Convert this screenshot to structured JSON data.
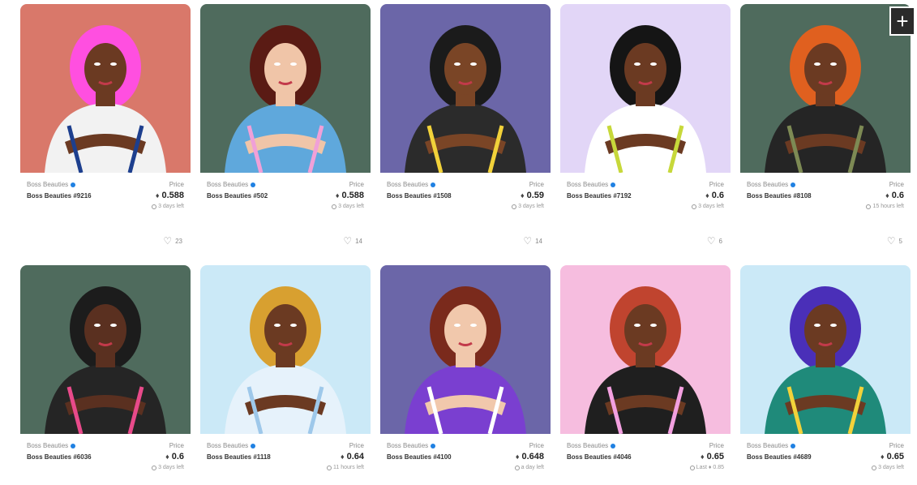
{
  "plus_button": {
    "label": "+"
  },
  "cards": [
    {
      "collection": "Boss Beauties",
      "name": "Boss Beauties #9216",
      "price_label": "Price",
      "price": "0.588",
      "time": "3 days left",
      "likes": "23",
      "bg": "#d9786a",
      "hair": "#ff4fe0",
      "top": "#f2f2f2",
      "accent": "#1d3f8e"
    },
    {
      "collection": "Boss Beauties",
      "name": "Boss Beauties #502",
      "price_label": "Price",
      "price": "0.588",
      "time": "3 days left",
      "likes": "14",
      "bg": "#4f6b5d",
      "hair": "#5a1b14",
      "top": "#5fa8dc",
      "accent": "#f0a0d8"
    },
    {
      "collection": "Boss Beauties",
      "name": "Boss Beauties #1508",
      "price_label": "Price",
      "price": "0.59",
      "time": "3 days left",
      "likes": "14",
      "bg": "#6b66a8",
      "hair": "#1b1b1b",
      "top": "#2b2b2b",
      "accent": "#f2d23a"
    },
    {
      "collection": "Boss Beauties",
      "name": "Boss Beauties #7192",
      "price_label": "Price",
      "price": "0.6",
      "time": "3 days left",
      "likes": "6",
      "bg": "#e2d6f7",
      "hair": "#151515",
      "top": "#ffffff",
      "accent": "#c7d83a"
    },
    {
      "collection": "Boss Beauties",
      "name": "Boss Beauties #8108",
      "price_label": "Price",
      "price": "0.6",
      "time": "15 hours left",
      "likes": "5",
      "bg": "#4f6b5d",
      "hair": "#e0601f",
      "top": "#252525",
      "accent": "#7d8a54"
    },
    {
      "collection": "Boss Beauties",
      "name": "Boss Beauties #6036",
      "price_label": "Price",
      "price": "0.6",
      "time": "3 days left",
      "likes": "",
      "bg": "#4f6b5d",
      "hair": "#1c1c1c",
      "top": "#252525",
      "accent": "#e84a8a"
    },
    {
      "collection": "Boss Beauties",
      "name": "Boss Beauties #1118",
      "price_label": "Price",
      "price": "0.64",
      "time": "11 hours left",
      "likes": "",
      "bg": "#cbe9f7",
      "hair": "#d8a030",
      "top": "#e6f2fb",
      "accent": "#9ec8ea"
    },
    {
      "collection": "Boss Beauties",
      "name": "Boss Beauties #4100",
      "price_label": "Price",
      "price": "0.648",
      "time": "a day left",
      "likes": "",
      "bg": "#6b66a8",
      "hair": "#7a2a1c",
      "top": "#7a3fd0",
      "accent": "#ffffff"
    },
    {
      "collection": "Boss Beauties",
      "name": "Boss Beauties #4046",
      "price_label": "Price",
      "price": "0.65",
      "time": "Last ♦ 0.85",
      "likes": "",
      "bg": "#f6bddf",
      "hair": "#c0442f",
      "top": "#1f1f1f",
      "accent": "#f3a0e0"
    },
    {
      "collection": "Boss Beauties",
      "name": "Boss Beauties #4689",
      "price_label": "Price",
      "price": "0.65",
      "time": "3 days left",
      "likes": "",
      "bg": "#cbe9f7",
      "hair": "#4a2fb8",
      "top": "#1f8a7a",
      "accent": "#f2d23a"
    }
  ]
}
